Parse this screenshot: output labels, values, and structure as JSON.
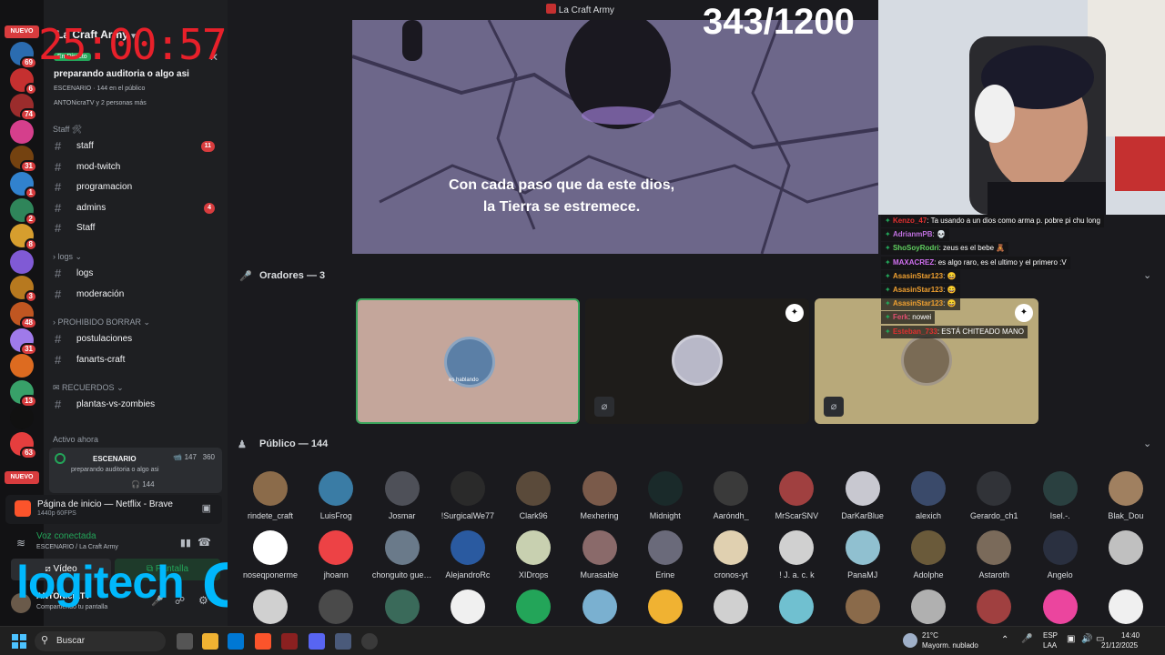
{
  "overlay": {
    "timer": "25:00:57",
    "counter": "343/1200",
    "nuevo_top": "NUEVO",
    "nuevo_bottom": "NUEVO"
  },
  "window": {
    "title": "La Craft Army"
  },
  "servers": [
    {
      "badge": "69",
      "color": "#2b6cb0"
    },
    {
      "badge": "6",
      "color": "#c53030"
    },
    {
      "badge": "74",
      "color": "#9b2c2c"
    },
    {
      "badge": "",
      "color": "#d53f8c"
    },
    {
      "badge": "31",
      "color": "#744210"
    },
    {
      "badge": "1",
      "color": "#3182ce"
    },
    {
      "badge": "2",
      "color": "#2f855a"
    },
    {
      "badge": "8",
      "color": "#d69e2e"
    },
    {
      "badge": "",
      "color": "#805ad5"
    },
    {
      "badge": "3",
      "color": "#b7791f"
    },
    {
      "badge": "48",
      "color": "#c05621"
    },
    {
      "badge": "31",
      "color": "#9f7aea"
    },
    {
      "badge": "",
      "color": "#dd6b20"
    },
    {
      "badge": "13",
      "color": "#38a169"
    },
    {
      "badge": "",
      "color": "#111111"
    },
    {
      "badge": "63",
      "color": "#e53e3e"
    }
  ],
  "sidebar": {
    "server_name": "La Craft Army",
    "live": {
      "pill": "En Directo",
      "title": "preparando auditoria o algo asi",
      "meta": "ESCENARIO  ·  144 en el público",
      "sub": "ANTONicraTV y 2 personas más"
    },
    "cat_staff": "Staff 🛠",
    "channels_staff": [
      {
        "label": "staff",
        "count": "11"
      },
      {
        "label": "mod-twitch",
        "count": ""
      },
      {
        "label": "programacion",
        "count": ""
      },
      {
        "label": "admins",
        "count": "4"
      },
      {
        "label": "Staff",
        "count": ""
      }
    ],
    "cat_logs": "logs",
    "channels_logs": [
      {
        "label": "logs"
      },
      {
        "label": "moderación"
      }
    ],
    "cat_prohibido": "PROHIBIDO BORRAR",
    "channels_prohibido": [
      {
        "label": "postulaciones"
      },
      {
        "label": "fanarts-craft"
      }
    ],
    "cat_recuerdos": "RECUERDOS",
    "channels_recuerdos": [
      {
        "label": "plantas-vs-zombies"
      }
    ],
    "active_now": "Activo ahora",
    "stage_card": {
      "name": "ESCENARIO",
      "views": "147",
      "count": "360",
      "sub": "preparando auditoria o algo asi",
      "listeners": "144"
    },
    "browser": {
      "title": "Página de inicio — Netflix - Brave",
      "sub": "1440p 60FPS"
    },
    "voice": {
      "title": "Voz conectada",
      "sub": "ESCENARIO / La Craft Army",
      "video_label": "Vídeo",
      "screen_label": "Pantalla"
    },
    "user": {
      "name": "ANTONicraTV",
      "status": "Compartiendo tu pantalla"
    },
    "logo_text": "logitech",
    "logo_g": "G"
  },
  "stage": {
    "caption_line1": "Con cada paso que da este dios,",
    "caption_line2": "la Tierra se estremece.",
    "speakers_header": "Oradores — 3",
    "audience_header": "Público — 144",
    "speakers": [
      {
        "bg": "#c4a69b",
        "avatar": "#5b7fa6",
        "label": "es hablando",
        "active": true
      },
      {
        "bg": "#1e1c1a",
        "avatar": "#b8b8c8",
        "label": "",
        "active": false
      },
      {
        "bg": "#b8a97a",
        "avatar": "#7a6b55",
        "label": "",
        "active": false
      }
    ],
    "audience": [
      {
        "name": "rindete_craft",
        "color": "#8b6b4a"
      },
      {
        "name": "LuisFrog",
        "color": "#3a7ca5"
      },
      {
        "name": "Josmar",
        "color": "#4e5058"
      },
      {
        "name": "!SurgicalWe77",
        "color": "#2a2a2a"
      },
      {
        "name": "Clark96",
        "color": "#5a4a3a"
      },
      {
        "name": "Mexhering",
        "color": "#7a5a4a"
      },
      {
        "name": "Midnight",
        "color": "#1a2a2a"
      },
      {
        "name": "Aaróndh_",
        "color": "#3a3a3a"
      },
      {
        "name": "MrScarSNV",
        "color": "#a04040"
      },
      {
        "name": "DarKarBlue",
        "color": "#c8c8d0"
      },
      {
        "name": "alexich",
        "color": "#3a4a6a"
      },
      {
        "name": "Gerardo_ch1",
        "color": "#313338"
      },
      {
        "name": "Isel.-.",
        "color": "#2a4040"
      },
      {
        "name": "Blak_Dou",
        "color": "#a08060"
      },
      {
        "name": "noseqponerme",
        "color": "#ffffff"
      },
      {
        "name": "jhoann",
        "color": "#ed4245"
      },
      {
        "name": "chonguito gue…",
        "color": "#6a7a8a"
      },
      {
        "name": "AlejandroRc",
        "color": "#2a5aa0"
      },
      {
        "name": "XIDrops",
        "color": "#c8d0b0"
      },
      {
        "name": "Murasable",
        "color": "#8a6a6a"
      },
      {
        "name": "Erine",
        "color": "#6a6a7a"
      },
      {
        "name": "cronos-yt",
        "color": "#e0d0b0"
      },
      {
        "name": "! J. a. c. k",
        "color": "#d0d0d0"
      },
      {
        "name": "PanaMJ",
        "color": "#90c0d0"
      },
      {
        "name": "Adolphe",
        "color": "#6a5a3a"
      },
      {
        "name": "Astaroth",
        "color": "#7a6a5a"
      },
      {
        "name": "Angelo",
        "color": "#2a3040"
      },
      {
        "name": "",
        "color": "#c0c0c0"
      },
      {
        "name": "",
        "color": "#d0d0d0"
      },
      {
        "name": "",
        "color": "#4a4a4a"
      },
      {
        "name": "",
        "color": "#3a6a5a"
      },
      {
        "name": "",
        "color": "#f0f0f0"
      },
      {
        "name": "",
        "color": "#23a559"
      },
      {
        "name": "",
        "color": "#7ab0d0"
      },
      {
        "name": "",
        "color": "#f0b232"
      },
      {
        "name": "",
        "color": "#d0d0d0"
      },
      {
        "name": "",
        "color": "#70c0d0"
      },
      {
        "name": "",
        "color": "#8a6a4a"
      },
      {
        "name": "",
        "color": "#b0b0b0"
      },
      {
        "name": "",
        "color": "#a04040"
      },
      {
        "name": "",
        "color": "#eb459e"
      },
      {
        "name": "",
        "color": "#f0f0f0"
      }
    ]
  },
  "chat": [
    {
      "user": "Kenzo_47",
      "user_color": "#e03030",
      "text": ": Ta usando a un dios como arma p. pobre pi chu long"
    },
    {
      "user": "AdrianmPB",
      "user_color": "#c070e0",
      "text": ": 💀"
    },
    {
      "user": "ShoSoyRodri",
      "user_color": "#60d060",
      "text": ": zeus es el bebe 🧸"
    },
    {
      "user": "MAXACREZ",
      "user_color": "#d070f0",
      "text": ": es algo raro, es el ultimo y el primero :V"
    },
    {
      "user": "AsasinStar123",
      "user_color": "#f0a030",
      "text": ": 😄"
    },
    {
      "user": "AsasinStar123",
      "user_color": "#f0a030",
      "text": ": 😄"
    },
    {
      "user": "AsasinStar123",
      "user_color": "#f0a030",
      "text": ": 😄"
    },
    {
      "user": "Ferk",
      "user_color": "#e05070",
      "text": ": nowei"
    },
    {
      "user": "Esteban_733",
      "user_color": "#e03030",
      "text": ": ESTÁ CHITEADO MANO"
    }
  ],
  "taskbar": {
    "search": "Buscar",
    "weather_temp": "21°C",
    "weather_desc": "Mayorm. nublado",
    "lang1": "ESP",
    "lang2": "LAA",
    "time": "14:40",
    "date": "21/12/2025"
  }
}
